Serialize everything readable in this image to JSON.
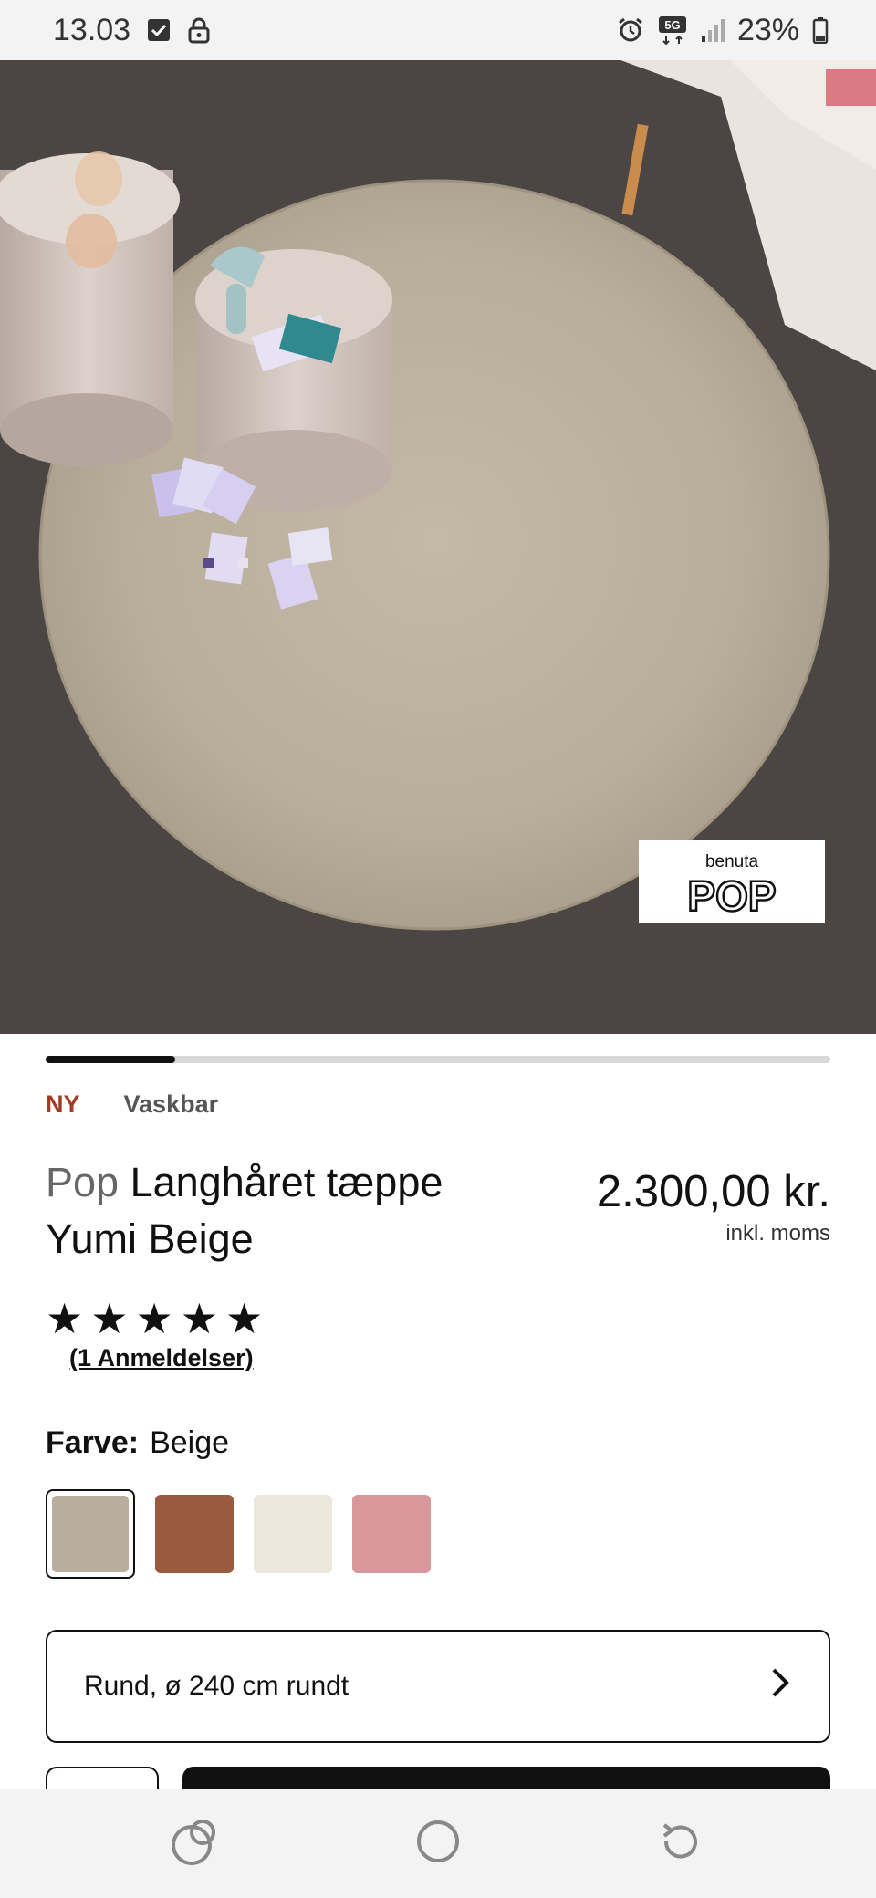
{
  "status_bar": {
    "time": "13.03",
    "battery": "23%",
    "network": "5G"
  },
  "hero": {
    "logo_small": "benuta",
    "logo_big": "POP",
    "carousel_progress": 0.165
  },
  "tags": {
    "new": "NY",
    "washable": "Vaskbar"
  },
  "product": {
    "brand": "Pop",
    "name_line1": "Langhåret tæppe",
    "name_line2": "Yumi Beige",
    "price": "2.300,00 kr.",
    "vat_note": "inkl. moms",
    "rating": 5,
    "stars": [
      "★",
      "★",
      "★",
      "★",
      "★"
    ],
    "reviews": "(1 Anmeldelser)"
  },
  "color": {
    "label": "Farve:",
    "value": "Beige",
    "swatches": [
      {
        "name": "beige",
        "color": "#b9ae9e",
        "selected": true
      },
      {
        "name": "brown",
        "color": "#9a5a3e",
        "selected": false
      },
      {
        "name": "cream",
        "color": "#ece7dc",
        "selected": false
      },
      {
        "name": "rose",
        "color": "#d8979a",
        "selected": false
      }
    ]
  },
  "size": {
    "value": "Rund, ø 240 cm rundt"
  },
  "colors": {
    "accent_new": "#a33a23",
    "text": "#111111",
    "floor": "#4b4644",
    "rug": "#bcb09e"
  }
}
